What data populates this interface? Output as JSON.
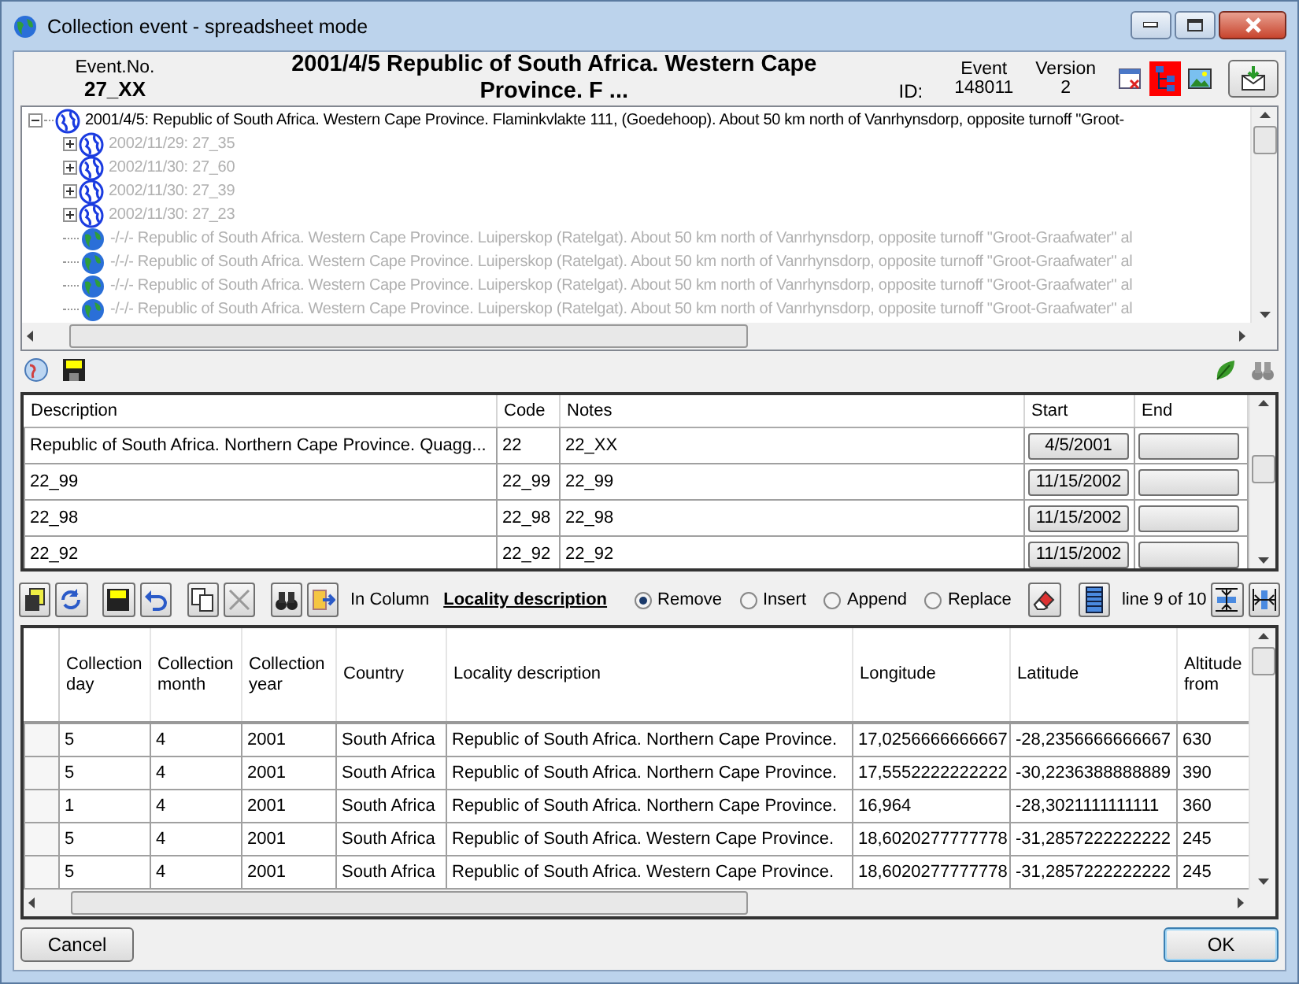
{
  "window": {
    "title": "Collection event - spreadsheet mode"
  },
  "header": {
    "event_no_label": "Event.No.",
    "event_no": "27_XX",
    "title": "2001/4/5 Republic of South Africa. Western Cape Province. F ...",
    "event_label": "Event",
    "id_label": "ID:",
    "id": "148011",
    "version_label": "Version",
    "version": "2"
  },
  "tree": {
    "label": "2001/4/5: Republic of South Africa. Western Cape Province. Flaminkvlakte 111, (Goedehoop). About 50 km north of Vanrhynsdorp, opposite turnoff \"Groot-",
    "kind": "event",
    "expanded": true,
    "greyed": false,
    "children": [
      {
        "label": "2002/11/29: 27_35",
        "kind": "event",
        "expanded": false,
        "greyed": true
      },
      {
        "label": "2002/11/30: 27_60",
        "kind": "event",
        "expanded": false,
        "greyed": true
      },
      {
        "label": "2002/11/30: 27_39",
        "kind": "event",
        "expanded": false,
        "greyed": true
      },
      {
        "label": "2002/11/30: 27_23",
        "kind": "event",
        "expanded": false,
        "greyed": true
      },
      {
        "label": "-/-/- Republic of South Africa. Western Cape Province. Luiperskop (Ratelgat). About 50 km north of Vanrhynsdorp, opposite turnoff \"Groot-Graafwater\" al",
        "kind": "site",
        "greyed": true
      },
      {
        "label": "-/-/- Republic of South Africa. Western Cape Province. Luiperskop (Ratelgat). About 50 km north of Vanrhynsdorp, opposite turnoff \"Groot-Graafwater\" al",
        "kind": "site",
        "greyed": true
      },
      {
        "label": "-/-/- Republic of South Africa. Western Cape Province. Luiperskop (Ratelgat). About 50 km north of Vanrhynsdorp, opposite turnoff \"Groot-Graafwater\" al",
        "kind": "site",
        "greyed": true
      },
      {
        "label": "-/-/- Republic of South Africa. Western Cape Province. Luiperskop (Ratelgat). About 50 km north of Vanrhynsdorp, opposite turnoff \"Groot-Graafwater\" al",
        "kind": "site",
        "greyed": true
      }
    ]
  },
  "sites_table": {
    "columns": [
      "Description",
      "Code",
      "Notes",
      "Start",
      "End"
    ],
    "rows": [
      {
        "description": "Republic of South Africa. Northern Cape Province. Quagg...",
        "code": "22",
        "notes": "22_XX",
        "start": "4/5/2001"
      },
      {
        "description": "22_99",
        "code": "22_99",
        "notes": "22_99",
        "start": "11/15/2002"
      },
      {
        "description": "22_98",
        "code": "22_98",
        "notes": "22_98",
        "start": "11/15/2002"
      },
      {
        "description": "22_92",
        "code": "22_92",
        "notes": "22_92",
        "start": "11/15/2002"
      }
    ]
  },
  "edit_toolbar": {
    "in_column_label": "In Column",
    "column": "Locality description",
    "modes": [
      {
        "label": "Remove",
        "selected": true
      },
      {
        "label": "Insert",
        "selected": false
      },
      {
        "label": "Append",
        "selected": false
      },
      {
        "label": "Replace",
        "selected": false
      }
    ],
    "line_info": "line 9 of 10"
  },
  "grid": {
    "columns": [
      "Collection day",
      "Collection month",
      "Collection year",
      "Country",
      "Locality description",
      "Longitude",
      "Latitude",
      "Altitude from"
    ],
    "rows": [
      [
        "5",
        "4",
        "2001",
        "South Africa",
        "Republic of South Africa. Northern Cape Province.",
        "17,0256666666667",
        "-28,2356666666667",
        "630"
      ],
      [
        "5",
        "4",
        "2001",
        "South Africa",
        "Republic of South Africa. Northern Cape Province.",
        "17,5552222222222",
        "-30,2236388888889",
        "390"
      ],
      [
        "1",
        "4",
        "2001",
        "South Africa",
        "Republic of South Africa. Northern Cape Province.",
        "16,964",
        "-28,3021111111111",
        "360"
      ],
      [
        "5",
        "4",
        "2001",
        "South Africa",
        "Republic of South Africa. Western Cape Province.",
        "18,6020277777778",
        "-31,2857222222222",
        "245"
      ],
      [
        "5",
        "4",
        "2001",
        "South Africa",
        "Republic of South Africa. Western Cape Province.",
        "18,6020277777778",
        "-31,2857222222222",
        "245"
      ]
    ]
  },
  "buttons": {
    "cancel": "Cancel",
    "ok": "OK"
  }
}
